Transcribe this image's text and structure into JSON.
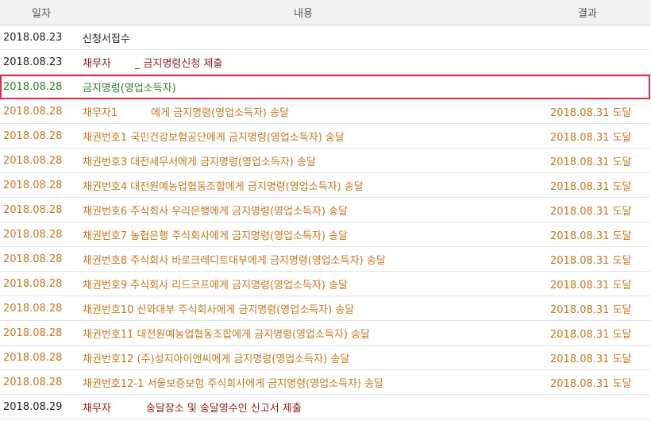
{
  "header": {
    "date": "일자",
    "content": "내용",
    "result": "결과"
  },
  "rows": [
    {
      "date": "2018.08.23",
      "part1": "신청서접수",
      "part2": "",
      "result": ""
    },
    {
      "date": "2018.08.23",
      "part1": "채무자",
      "part2": "_ 금지명령신청 제출",
      "result": ""
    },
    {
      "date": "2018.08.28",
      "part1": "금지명령(영업소득자)",
      "part2": "",
      "result": ""
    },
    {
      "date": "2018.08.28",
      "part1": "채무자1",
      "part2": "에게 금지명령(영업소득자) 송달",
      "result": "2018.08.31 도달"
    },
    {
      "date": "2018.08.28",
      "part1": "채권번호1 국민건강보험공단에게 금지명령(영업소득자) 송달",
      "part2": "",
      "result": "2018.08.31 도달"
    },
    {
      "date": "2018.08.28",
      "part1": "채권번호3 대전세무서에게 금지명령(영업소득자) 송달",
      "part2": "",
      "result": "2018.08.31 도달"
    },
    {
      "date": "2018.08.28",
      "part1": "채권번호4 대전원예농업협동조합에게 금지명령(영업소득자) 송달",
      "part2": "",
      "result": "2018.08.31 도달"
    },
    {
      "date": "2018.08.28",
      "part1": "채권번호6 주식회사 우리은행에게 금지명령(영업소득자) 송달",
      "part2": "",
      "result": "2018.08.31 도달"
    },
    {
      "date": "2018.08.28",
      "part1": "채권번호7 농협은행 주식회사에게 금지명령(영업소득자) 송달",
      "part2": "",
      "result": "2018.08.31 도달"
    },
    {
      "date": "2018.08.28",
      "part1": "채권번호8 주식회사 바로크레디트대부에게 금지명령(영업소득자) 송달",
      "part2": "",
      "result": "2018.08.31 도달"
    },
    {
      "date": "2018.08.28",
      "part1": "채권번호9 주식회사 리드코프에게 금지명령(영업소득자) 송달",
      "part2": "",
      "result": "2018.08.31 도달"
    },
    {
      "date": "2018.08.28",
      "part1": "채권번호10 산와대부 주식회사에게 금지명령(영업소득자) 송달",
      "part2": "",
      "result": "2018.08.31 도달"
    },
    {
      "date": "2018.08.28",
      "part1": "채권번호11 대전원예농업협동조합에게 금지명령(영업소득자) 송달",
      "part2": "",
      "result": "2018.08.31 도달"
    },
    {
      "date": "2018.08.28",
      "part1": "채권번호12 (주)성지아이앤씨에게 금지명령(영업소득자) 송달",
      "part2": "",
      "result": "2018.08.31 도달"
    },
    {
      "date": "2018.08.28",
      "part1": "채권번호12-1 서울보증보험 주식회사에게 금지명령(영업소득자) 송달",
      "part2": "",
      "result": "2018.08.31 도달"
    },
    {
      "date": "2018.08.29",
      "part1": "채무자",
      "part2": "송달장소 및 송달영수인 신고서 제출",
      "result": ""
    }
  ],
  "colors": {
    "highlight": "#e0284a",
    "orange": "#c0781f",
    "green": "#2e7d32",
    "maroon": "#8b1a1a"
  }
}
